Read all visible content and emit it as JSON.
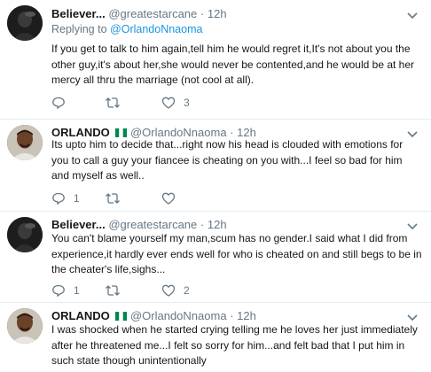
{
  "tweets": [
    {
      "display_name": "Believer...",
      "handle": "@greatestarcane",
      "time": "12h",
      "replying_prefix": "Replying to",
      "replying_handle": "@OrlandoNnaoma",
      "text": "If you get to talk to him again,tell him he would regret it,It's not about you the other guy,it's about her,she would never be contented,and he would be at her mercy all thru the marriage (not cool at all).",
      "reply_count": "",
      "retweet_count": "",
      "like_count": "3",
      "avatar": "dark-shadow-avatar"
    },
    {
      "display_name": "ORLANDO",
      "handle": "@OrlandoNnaoma",
      "time": "12h",
      "text": "Its upto him to decide that...right now his head is clouded with emotions for you to call a guy your fiancee is cheating on you with...I feel so bad for him and myself as well..",
      "reply_count": "1",
      "retweet_count": "",
      "like_count": "",
      "avatar": "portrait-avatar"
    },
    {
      "display_name": "Believer...",
      "handle": "@greatestarcane",
      "time": "12h",
      "text": "You can't blame yourself my man,scum has no gender.I said what I did from experience,it hardly ever ends well for who is cheated on and still begs to be in the cheater's life,sighs...",
      "reply_count": "1",
      "retweet_count": "",
      "like_count": "2",
      "avatar": "dark-shadow-avatar"
    },
    {
      "display_name": "ORLANDO",
      "handle": "@OrlandoNnaoma",
      "time": "12h",
      "text": "I was shocked when he started crying  telling me he loves her just immediately after he threatened me...I felt so sorry for him...and felt bad that I put him in such state though unintentionally",
      "avatar": "portrait-avatar"
    }
  ],
  "colors": {
    "link": "#1b95e0",
    "muted": "#657786",
    "divider": "#e6ecf0",
    "flag_green": "#008751"
  }
}
